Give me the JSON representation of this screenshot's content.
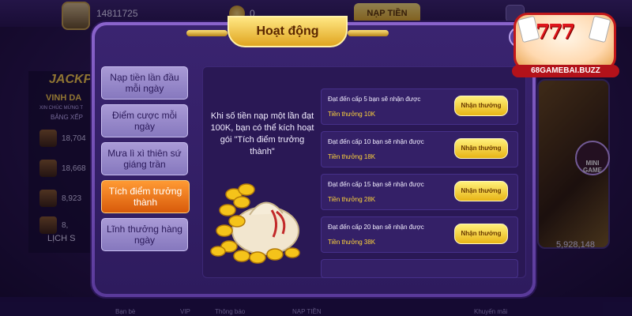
{
  "background": {
    "balance": "14811725",
    "coin_amount": "0",
    "deposit_button": "NẠP TIỀN",
    "jackpot_title": "JACKP",
    "vinh_danh": "VINH DA",
    "xin_chuc": "XIN CHÚC MỪNG T",
    "bang_xep": "BẢNG XẾP",
    "rank_values": [
      "18,704",
      "18,668",
      "8,923",
      "8,"
    ],
    "history": "LỊCH S",
    "mini_game": "MINI GAME",
    "right_amount": "5,928,148",
    "bottom_items": [
      "Bạn bè",
      "VIP",
      "Thông báo",
      "NẠP TIỀN",
      "Khuyến mãi"
    ]
  },
  "logo": {
    "digits": "777",
    "text": "68GAMEBAI.BUZZ"
  },
  "modal": {
    "title": "Hoạt động",
    "close_symbol": "✕",
    "menu": [
      {
        "label": "Nạp tiền lần đầu mỗi ngày"
      },
      {
        "label": "Điểm cược mỗi ngày"
      },
      {
        "label": "Mưa lì xì thiên sứ giáng trần"
      },
      {
        "label": "Tích điểm trưởng thành"
      },
      {
        "label": "Lĩnh thưởng hàng ngày"
      }
    ],
    "active_index": 3,
    "description": "Khi số tiền nạp một lần đạt 100K, bạn có thể kích hoạt gói \"Tích điểm trưởng thành\"",
    "rewards": [
      {
        "condition": "Đạt đến cấp 5 bạn sẽ nhận được",
        "amount": "Tiền thưởng 10K",
        "button": "Nhận thưởng"
      },
      {
        "condition": "Đạt đến cấp 10 bạn sẽ nhận được",
        "amount": "Tiền thưởng 18K",
        "button": "Nhận thưởng"
      },
      {
        "condition": "Đạt đến cấp 15 bạn sẽ nhận được",
        "amount": "Tiền thưởng 28K",
        "button": "Nhận thưởng"
      },
      {
        "condition": "Đạt đến cấp 20 bạn sẽ nhận được",
        "amount": "Tiền thưởng 38K",
        "button": "Nhận thưởng"
      }
    ]
  },
  "colors": {
    "accent_gold": "#ffd43a",
    "active_orange": "#e8720f",
    "panel_purple": "#2e1b5e"
  }
}
